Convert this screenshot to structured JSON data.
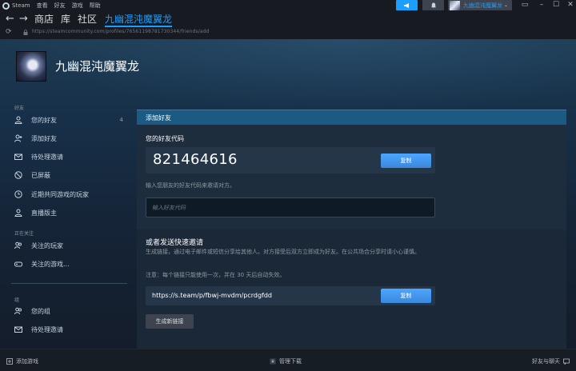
{
  "titlebar": {
    "app_name": "Steam",
    "menu": [
      "查看",
      "好友",
      "游戏",
      "帮助"
    ],
    "announce_icon": "megaphone-icon",
    "notify_icon": "bell-icon",
    "account_name": "九幽混沌魔翼龙",
    "window_controls": [
      "minimize",
      "maximize",
      "close"
    ]
  },
  "nav": {
    "back_icon": "arrow-left-icon",
    "forward_icon": "arrow-right-icon",
    "store": "商店",
    "library": "库",
    "community": "社区",
    "profile": "九幽混沌魔翼龙"
  },
  "urlbar": {
    "url": "https://steamcommunity.com/profiles/76561198781730344/friends/add"
  },
  "profile": {
    "name": "九幽混沌魔翼龙"
  },
  "sidebar": {
    "friends_heading": "好友",
    "friends_items": [
      {
        "label": "您的好友",
        "count": "4",
        "icon": "person-icon"
      },
      {
        "label": "添加好友",
        "count": "",
        "icon": "add-person-icon"
      },
      {
        "label": "待处理邀请",
        "count": "",
        "icon": "mail-icon"
      },
      {
        "label": "已屏蔽",
        "count": "",
        "icon": "block-icon"
      },
      {
        "label": "近期共同游戏的玩家",
        "count": "",
        "icon": "clock-icon"
      },
      {
        "label": "直播版主",
        "count": "",
        "icon": "person-icon"
      }
    ],
    "following_heading": "正在关注",
    "following_items": [
      {
        "label": "关注的玩家",
        "icon": "people-icon"
      },
      {
        "label": "关注的游戏...",
        "icon": "gamepad-icon"
      }
    ],
    "groups_heading": "组",
    "group_items": [
      {
        "label": "您的组",
        "icon": "people-icon"
      },
      {
        "label": "待处理邀请",
        "icon": "mail-icon"
      }
    ]
  },
  "panel": {
    "title": "添加好友",
    "code_label": "您的好友代码",
    "friend_code": "821464616",
    "copy_label": "复制",
    "code_hint": "输入您朋友的好友代码来邀请对方。",
    "input_placeholder": "输入好友代码",
    "invite_title": "或者发送快速邀请",
    "invite_desc": "生成链接，通过电子邮件或短信分享给其他人。对方接受后双方立即成为好友。在公共场合分享时请小心谨慎。",
    "invite_note": "注意：每个链接只能使用一次，并在 30 天后自动失效。",
    "invite_link": "https://s.team/p/fbwj-mvdm/pcrdgfdd",
    "copy_link_label": "复制",
    "new_link_label": "生成新链接"
  },
  "bottombar": {
    "add_game": "添加游戏",
    "manage_downloads": "管理下载",
    "friends_chat": "好友与聊天"
  }
}
